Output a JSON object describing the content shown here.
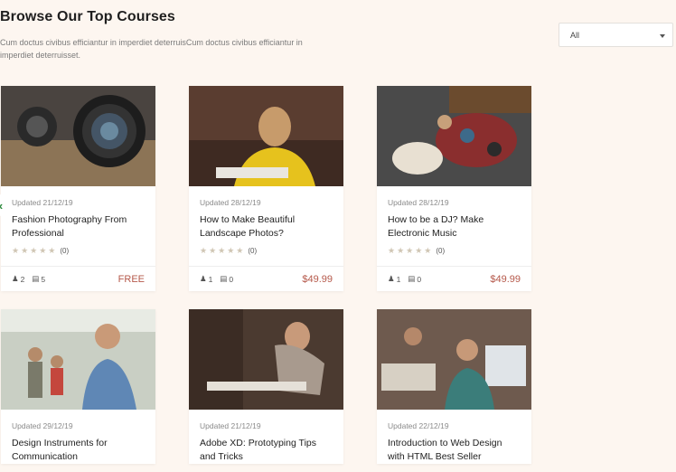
{
  "header": {
    "title": "Browse Our Top Courses",
    "description": "Cum doctus civibus efficiantur in imperdiet deterruisCum doctus civibus efficiantur in imperdiet deterruisset."
  },
  "filter": {
    "selected": "All"
  },
  "courses": [
    {
      "updated": "Updated 21/12/19",
      "title": "Fashion Photography From Professional",
      "rating_count": "(0)",
      "students": "2",
      "lessons": "5",
      "price": "FREE"
    },
    {
      "updated": "Updated 28/12/19",
      "title": "How to Make Beautiful Landscape Photos?",
      "rating_count": "(0)",
      "students": "1",
      "lessons": "0",
      "price": "$49.99"
    },
    {
      "updated": "Updated 28/12/19",
      "title": "How to be a DJ? Make Electronic Music",
      "rating_count": "(0)",
      "students": "1",
      "lessons": "0",
      "price": "$49.99"
    },
    {
      "updated": "Updated 29/12/19",
      "title": "Design Instruments for Communication"
    },
    {
      "updated": "Updated 21/12/19",
      "title": "Adobe XD: Prototyping Tips and Tricks"
    },
    {
      "updated": "Updated 22/12/19",
      "title": "Introduction to Web Design with HTML Best Seller"
    }
  ],
  "icons": {
    "stars": "★★★★★"
  }
}
